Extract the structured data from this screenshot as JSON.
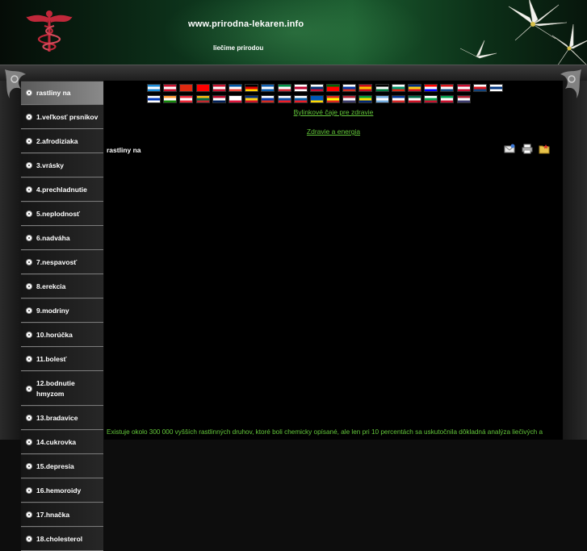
{
  "header": {
    "site_url": "www.prirodna-lekaren.info",
    "slogan": "liečime prirodou"
  },
  "colors": {
    "header_green": "#1a5a2e",
    "link_green": "#63c73a",
    "logo_red": "#c0283a",
    "background": "#000000"
  },
  "sidebar": {
    "items": [
      {
        "label": "rastliny na",
        "active": true
      },
      {
        "label": "1.veľkosť prsnikov"
      },
      {
        "label": "2.afrodiziaka"
      },
      {
        "label": "3.vrásky"
      },
      {
        "label": "4.prechladnutie"
      },
      {
        "label": "5.neplodnosť"
      },
      {
        "label": "6.nadváha"
      },
      {
        "label": "7.nespavosť"
      },
      {
        "label": "8.erekcia"
      },
      {
        "label": "9.modriny"
      },
      {
        "label": "10.horúčka"
      },
      {
        "label": "11.bolesť"
      },
      {
        "label": "12.bodnutie hmyzom"
      },
      {
        "label": "13.bradavice"
      },
      {
        "label": "14.cukrovka"
      },
      {
        "label": "15.depresia"
      },
      {
        "label": "16.hemoroidy"
      },
      {
        "label": "17.hnačka"
      },
      {
        "label": "18.cholesterol"
      }
    ]
  },
  "flags": {
    "row1": [
      [
        "#1c8cd8",
        "#ffffff",
        "#1c8cd8"
      ],
      [
        "#c8102e",
        "#ffffff",
        "#c8102e"
      ],
      [
        "#de2910",
        "#de2910",
        "#de2910"
      ],
      [
        "#fe0000",
        "#fe0000",
        "#fe0000"
      ],
      [
        "#c8102e",
        "#ffffff",
        "#c8102e"
      ],
      [
        "#0055a4",
        "#ffffff",
        "#ef4135"
      ],
      [
        "#000000",
        "#dd0000",
        "#ffce00"
      ],
      [
        "#0d5eaf",
        "#ffffff",
        "#0d5eaf"
      ],
      [
        "#009246",
        "#ffffff",
        "#ce2b37"
      ],
      [
        "#ffffff",
        "#bc002d",
        "#ffffff"
      ],
      [
        "#ffffff",
        "#003478",
        "#c60c30"
      ],
      [
        "#006600",
        "#ff0000",
        "#ff0000"
      ],
      [
        "#ffffff",
        "#0039a6",
        "#d52b1e"
      ],
      [
        "#c60b1e",
        "#ffc400",
        "#c60b1e"
      ],
      [
        "#000000",
        "#ffffff",
        "#007a3d"
      ],
      [
        "#ffffff",
        "#00966e",
        "#d62612"
      ],
      [
        "#002b7f",
        "#fcd116",
        "#ce1126"
      ],
      [
        "#ff0000",
        "#ffffff",
        "#0000ff"
      ],
      [
        "#d7141a",
        "#ffffff",
        "#11457e"
      ],
      [
        "#c60c30",
        "#ffffff",
        "#c60c30"
      ],
      [
        "#ffffff",
        "#d7141a",
        "#11457e"
      ],
      [
        "#ffffff",
        "#003580",
        "#ffffff"
      ]
    ],
    "row2": [
      [
        "#ffffff",
        "#0038b8",
        "#ffffff"
      ],
      [
        "#ff9933",
        "#ffffff",
        "#138808"
      ],
      [
        "#ed2939",
        "#ffffff",
        "#ed2939"
      ],
      [
        "#fdb913",
        "#006a44",
        "#c1272d"
      ],
      [
        "#ba0c2f",
        "#ffffff",
        "#00205b"
      ],
      [
        "#ffffff",
        "#ffffff",
        "#dc143c"
      ],
      [
        "#002b7f",
        "#fcd116",
        "#ce1126"
      ],
      [
        "#ffffff",
        "#0039a6",
        "#d52b1e"
      ],
      [
        "#ffffff",
        "#0b4ea2",
        "#ee1c25"
      ],
      [
        "#ffffff",
        "#005da4",
        "#ed1c24"
      ],
      [
        "#0057b7",
        "#0057b7",
        "#ffd700"
      ],
      [
        "#da251d",
        "#ffff00",
        "#da251d"
      ],
      [
        "#b22234",
        "#ffffff",
        "#3c3b6e"
      ],
      [
        "#009c3b",
        "#ffdf00",
        "#002776"
      ],
      [
        "#74acdf",
        "#ffffff",
        "#74acdf"
      ],
      [
        "#003897",
        "#ffffff",
        "#d72828"
      ],
      [
        "#006847",
        "#ffffff",
        "#ce1126"
      ],
      [
        "#ffffff",
        "#00a651",
        "#c8102e"
      ],
      [
        "#00a650",
        "#ffffff",
        "#c8102e"
      ],
      [
        "#b22234",
        "#ffffff",
        "#3c3b6e"
      ]
    ]
  },
  "links": {
    "link1": "Bylinkové čaje pre zdravie",
    "link2": "Zdravie a energia"
  },
  "page": {
    "heading": "rastliny na",
    "body_text": "Existuje okolo 300 000 vyšších rastlinných druhov, ktoré boli chemicky opísané, ale len pri 10 percentách sa uskutočnila dôkladná analýza liečivých a"
  },
  "tools": {
    "email_icon": "email-icon",
    "print_icon": "printer-icon",
    "favorite_icon": "folder-star-icon"
  }
}
